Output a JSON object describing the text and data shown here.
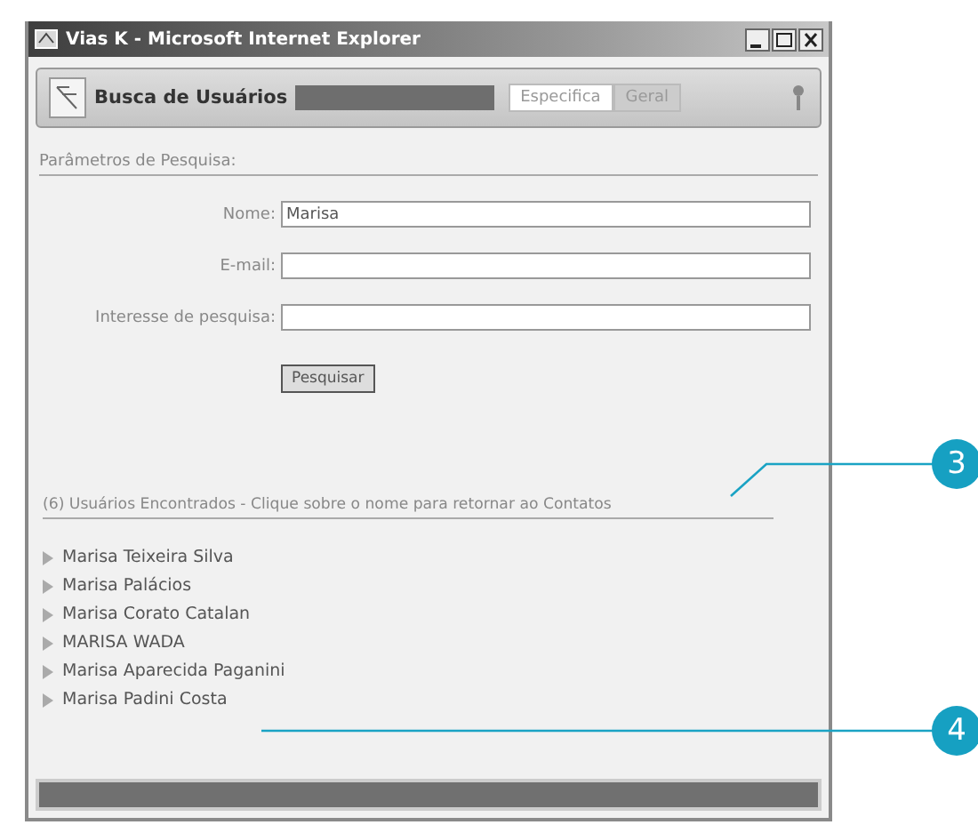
{
  "window": {
    "title": "Vias K - Microsoft Internet Explorer"
  },
  "header": {
    "title": "Busca de Usuários",
    "tabs": [
      {
        "label": "Especifica",
        "selected": true
      },
      {
        "label": "Geral",
        "selected": false
      }
    ]
  },
  "search": {
    "title": "Parâmetros de Pesquisa:",
    "fields": [
      {
        "label": "Nome:",
        "value": "Marisa"
      },
      {
        "label": "E-mail:"
      },
      {
        "label": "Interesse de pesquisa:"
      }
    ],
    "button": "Pesquisar"
  },
  "results": {
    "heading": "(6) Usuários Encontrados - Clique sobre o nome para retornar ao Contatos",
    "items": [
      "Marisa Teixeira Silva",
      "Marisa Palácios",
      "Marisa Corato Catalan",
      "MARISA WADA",
      "Marisa Aparecida Paganini",
      "Marisa Padini Costa"
    ]
  },
  "callouts": [
    "3",
    "4"
  ]
}
